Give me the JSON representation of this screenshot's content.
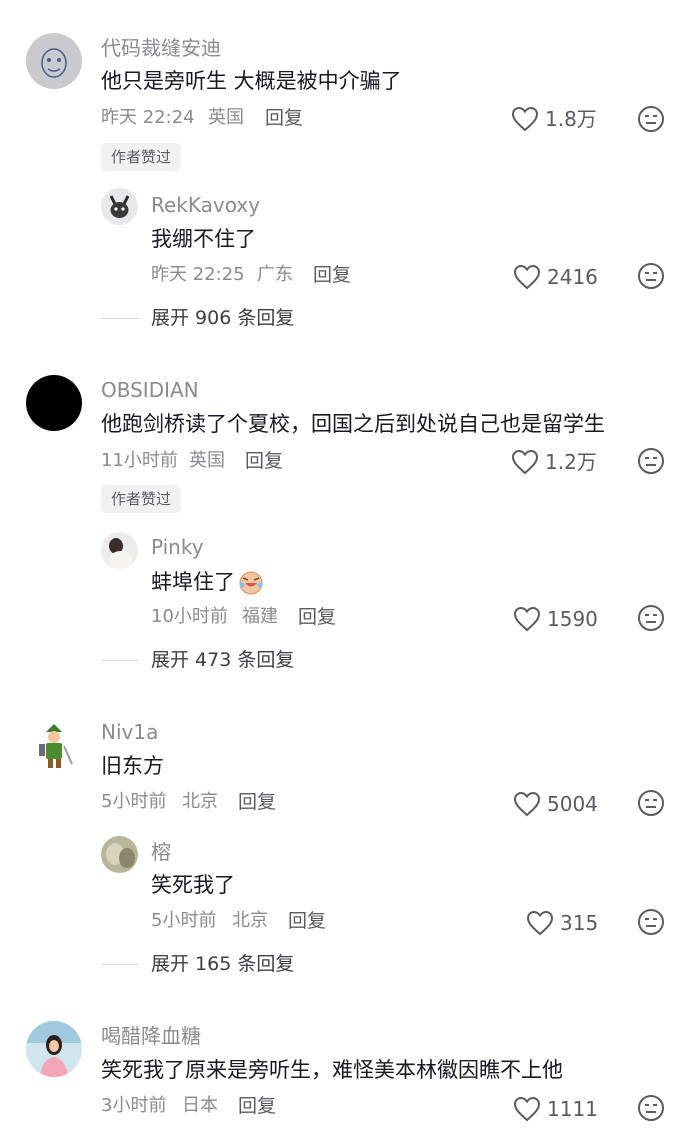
{
  "comments": [
    {
      "username": "代码裁缝安迪",
      "text": "他只是旁听生 大概是被中介骗了",
      "time": "昨天 22:24",
      "location": "英国",
      "reply": "回复",
      "likes": "1.8万",
      "badge": "作者赞过",
      "replies": [
        {
          "username": "RekKavoxy",
          "text": "我绷不住了",
          "time": "昨天 22:25",
          "location": "广东",
          "reply": "回复",
          "likes": "2416"
        }
      ],
      "expand": "展开 906 条回复"
    },
    {
      "username": "OBSIDIAN",
      "text": "他跑剑桥读了个夏校，回国之后到处说自己也是留学生",
      "time": "11小时前",
      "location": "英国",
      "reply": "回复",
      "likes": "1.2万",
      "badge": "作者赞过",
      "replies": [
        {
          "username": "Pinky",
          "text": "蚌埠住了",
          "time": "10小时前",
          "location": "福建",
          "reply": "回复",
          "likes": "1590"
        }
      ],
      "expand": "展开 473 条回复"
    },
    {
      "username": "Niv1a",
      "text": "旧东方",
      "time": "5小时前",
      "location": "北京",
      "reply": "回复",
      "likes": "5004",
      "replies": [
        {
          "username": "榕",
          "text": "笑死我了",
          "time": "5小时前",
          "location": "北京",
          "reply": "回复",
          "likes": "315"
        }
      ],
      "expand": "展开 165 条回复"
    },
    {
      "username": "喝醋降血糖",
      "text": "笑死我了原来是旁听生，难怪美本林徽因瞧不上他",
      "time": "3小时前",
      "location": "日本",
      "reply": "回复",
      "likes": "1111"
    }
  ],
  "icons": {
    "like": "heart-outline-icon",
    "dislike": "neutral-face-icon",
    "emoji": "crying-laugh-emoji"
  },
  "colors": {
    "username": "#8a8b91",
    "text": "#161823",
    "meta": "#8a8b91",
    "badge_bg": "#f1f1f2"
  }
}
